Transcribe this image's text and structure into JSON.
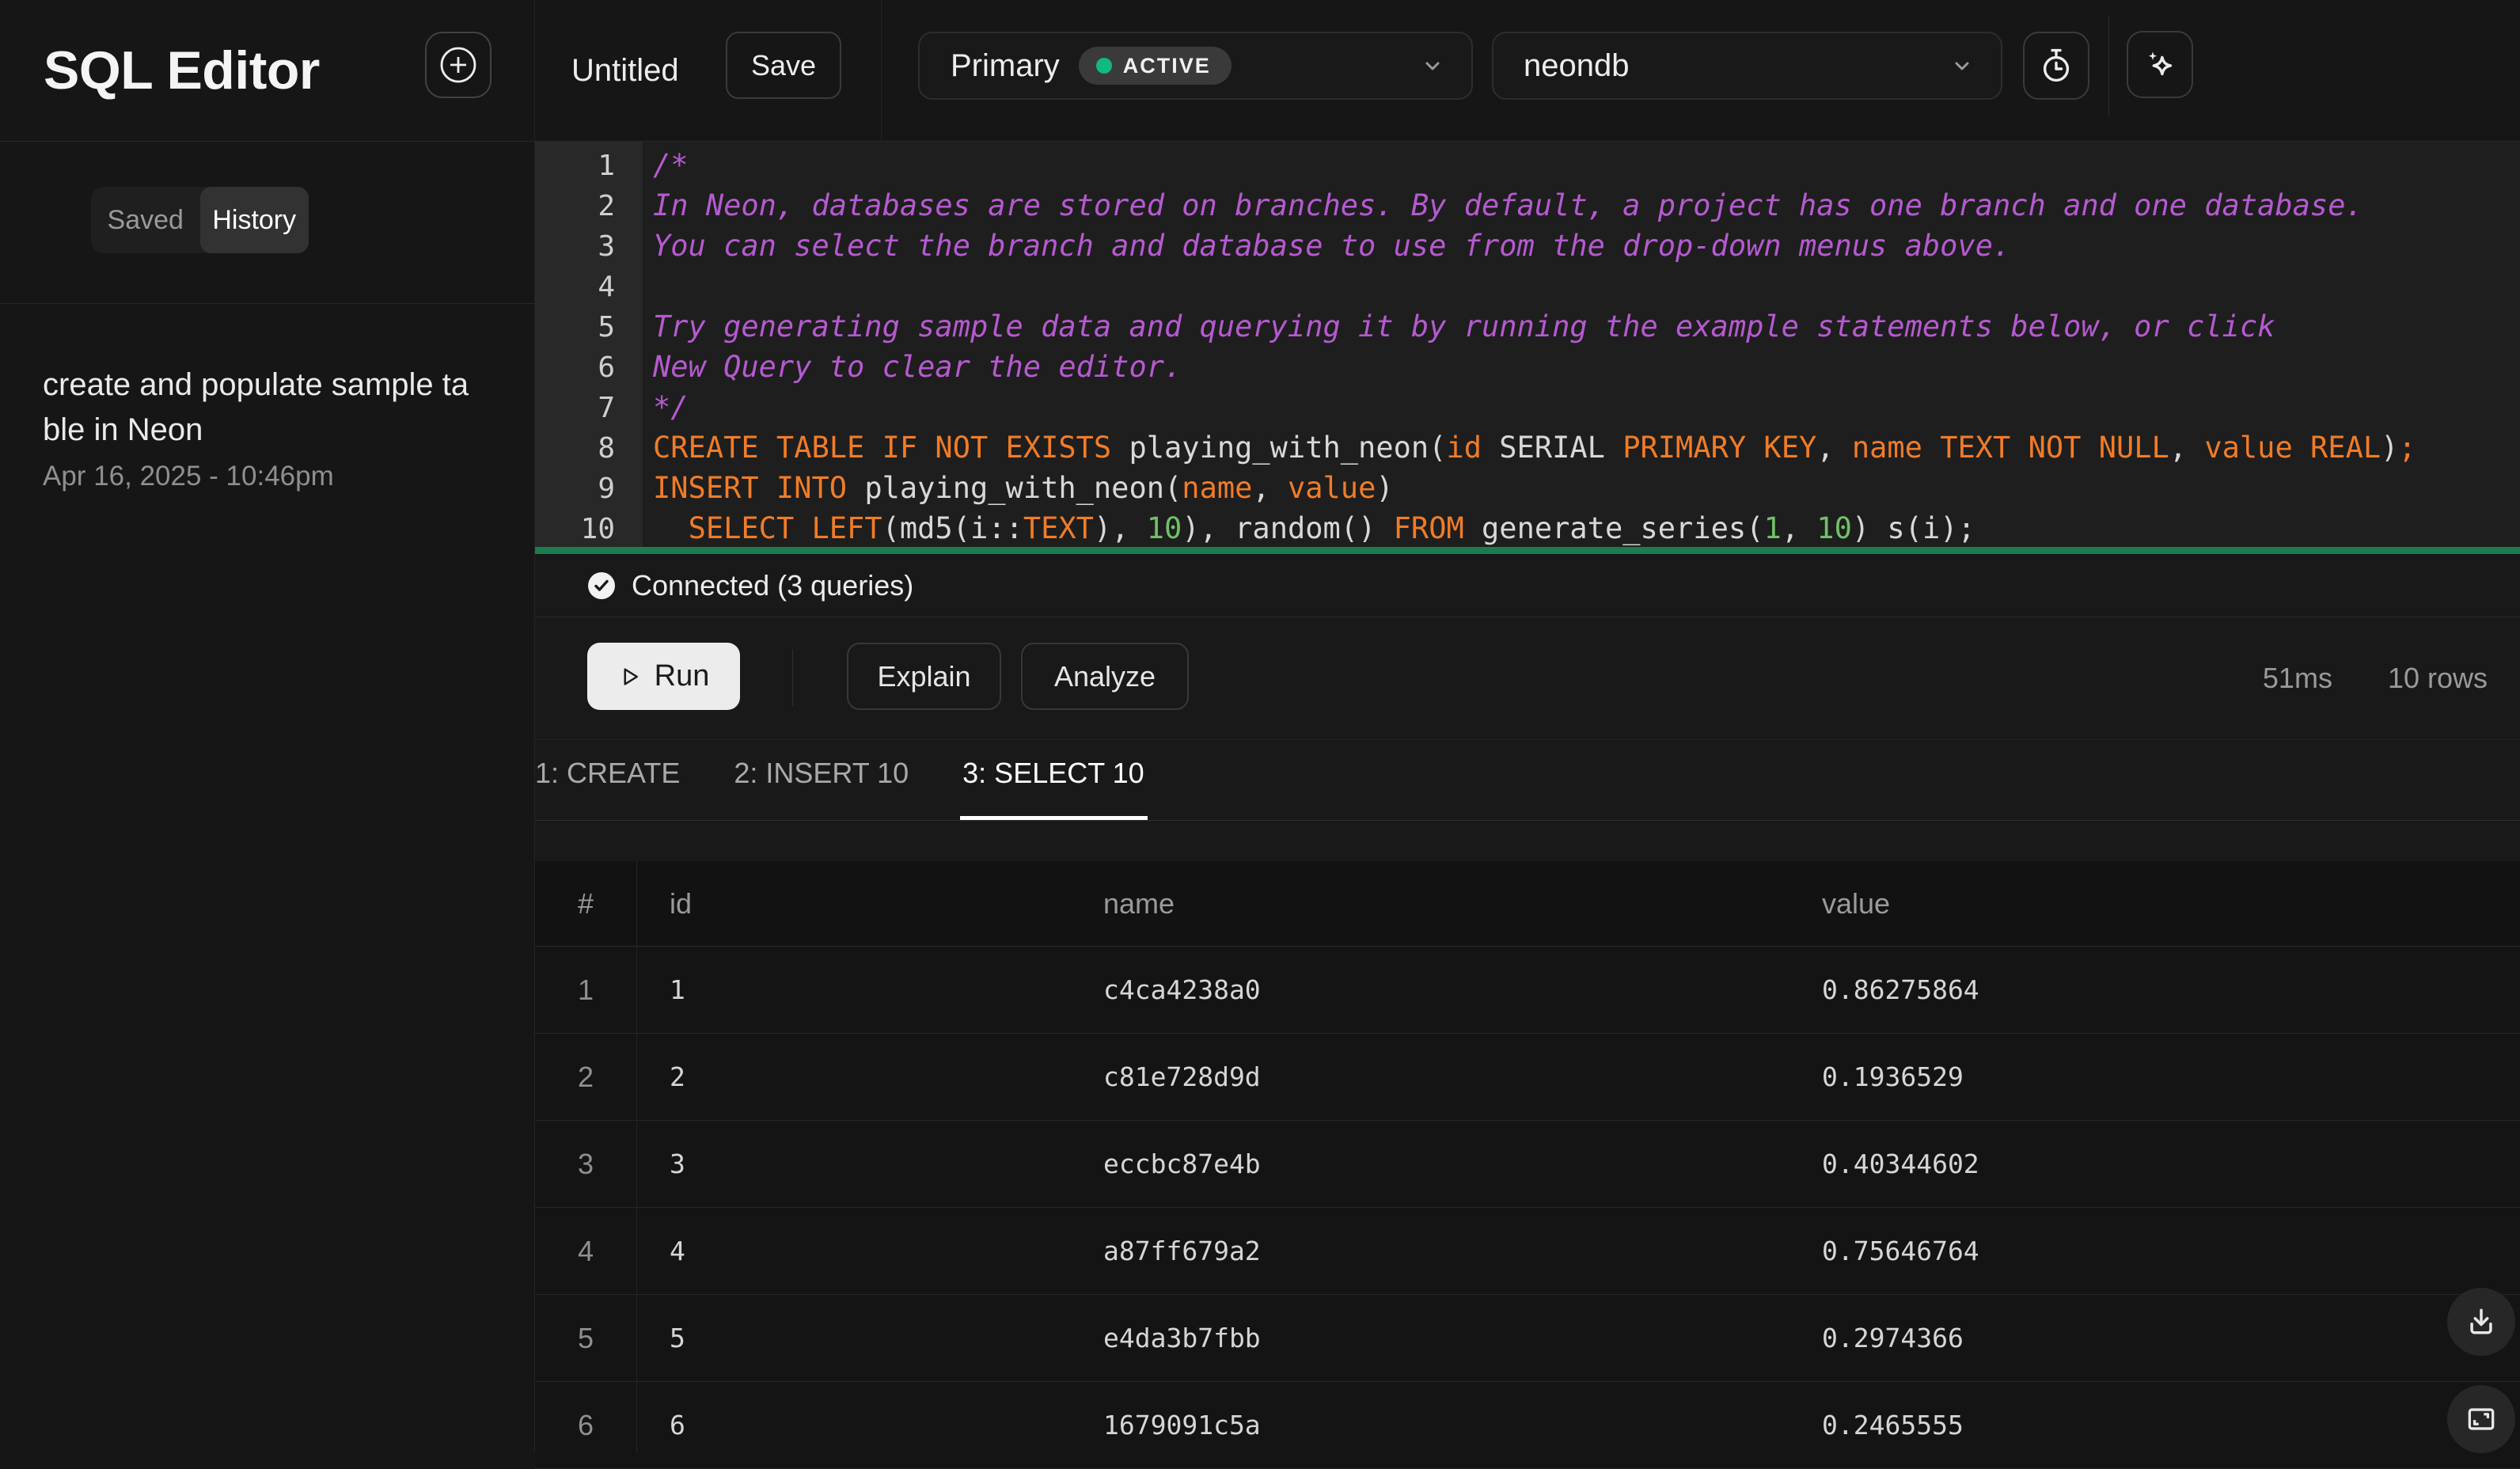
{
  "app": {
    "title": "SQL Editor"
  },
  "sidebar": {
    "tabs": [
      {
        "label": "Saved",
        "active": false
      },
      {
        "label": "History",
        "active": true
      }
    ],
    "history_items": [
      {
        "title": "create and populate sample table in Neon",
        "timestamp": "Apr 16, 2025 - 10:46pm"
      }
    ]
  },
  "topbar": {
    "query_name": "Untitled",
    "save_label": "Save",
    "branch": {
      "name": "Primary",
      "status": "ACTIVE"
    },
    "database": {
      "name": "neondb"
    }
  },
  "editor": {
    "lines": [
      [
        [
          "c",
          "/*"
        ]
      ],
      [
        [
          "c",
          "In Neon, databases are stored on branches. By default, a project has one branch and one database."
        ]
      ],
      [
        [
          "c",
          "You can select the branch and database to use from the drop-down menus above."
        ]
      ],
      [],
      [
        [
          "c",
          "Try generating sample data and querying it by running the example statements below, or click"
        ]
      ],
      [
        [
          "c",
          "New Query to clear the editor."
        ]
      ],
      [
        [
          "c",
          "*/"
        ]
      ],
      [
        [
          "k",
          "CREATE TABLE IF NOT EXISTS"
        ],
        [
          "p",
          " playing_with_neon("
        ],
        [
          "k",
          "id"
        ],
        [
          "p",
          " SERIAL "
        ],
        [
          "k",
          "PRIMARY KEY"
        ],
        [
          "p",
          ", "
        ],
        [
          "k",
          "name TEXT NOT NULL"
        ],
        [
          "p",
          ", "
        ],
        [
          "k",
          "value REAL"
        ],
        [
          "p",
          ")"
        ],
        [
          "k",
          ";"
        ]
      ],
      [
        [
          "k",
          "INSERT INTO"
        ],
        [
          "p",
          " playing_with_neon("
        ],
        [
          "k",
          "name"
        ],
        [
          "p",
          ", "
        ],
        [
          "k",
          "value"
        ],
        [
          "p",
          ")"
        ]
      ],
      [
        [
          "p",
          "  "
        ],
        [
          "k",
          "SELECT LEFT"
        ],
        [
          "p",
          "(md5(i::"
        ],
        [
          "k",
          "TEXT"
        ],
        [
          "p",
          "), "
        ],
        [
          "n",
          "10"
        ],
        [
          "p",
          "), random() "
        ],
        [
          "k",
          "FROM"
        ],
        [
          "p",
          " generate_series("
        ],
        [
          "n",
          "1"
        ],
        [
          "p",
          ", "
        ],
        [
          "n",
          "10"
        ],
        [
          "p",
          ") s(i);"
        ]
      ]
    ]
  },
  "status": {
    "text": "Connected (3 queries)"
  },
  "actions": {
    "run": "Run",
    "explain": "Explain",
    "analyze": "Analyze",
    "duration": "51ms",
    "rows": "10 rows"
  },
  "result_tabs": [
    {
      "label": "1: CREATE",
      "active": false
    },
    {
      "label": "2: INSERT 10",
      "active": false
    },
    {
      "label": "3: SELECT 10",
      "active": true
    }
  ],
  "results": {
    "columns": [
      "#",
      "id",
      "name",
      "value"
    ],
    "rows": [
      [
        "1",
        "1",
        "c4ca4238a0",
        "0.86275864"
      ],
      [
        "2",
        "2",
        "c81e728d9d",
        "0.1936529"
      ],
      [
        "3",
        "3",
        "eccbc87e4b",
        "0.40344602"
      ],
      [
        "4",
        "4",
        "a87ff679a2",
        "0.75646764"
      ],
      [
        "5",
        "5",
        "e4da3b7fbb",
        "0.2974366"
      ],
      [
        "6",
        "6",
        "1679091c5a",
        "0.2465555"
      ]
    ]
  },
  "colors": {
    "accent_green": "#10b981",
    "editor_rule": "#1c7b4f",
    "keyword": "#f07c28",
    "comment": "#b55ad0",
    "number": "#72c069"
  }
}
